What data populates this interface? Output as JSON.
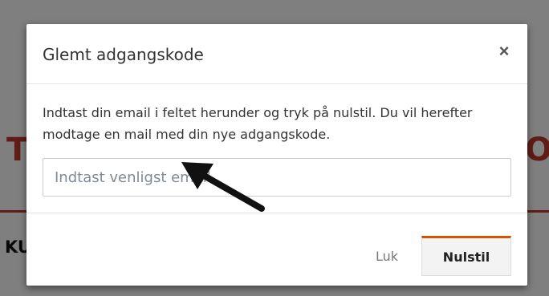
{
  "background": {
    "left_letter": "T",
    "right_letter": "O",
    "left_text": "KU",
    "accent_color": "#c0392b"
  },
  "modal": {
    "title": "Glemt adgangskode",
    "close_icon": "×",
    "help_text": "Indtast din email i feltet herunder og tryk på nulstil. Du vil herefter modtage en mail med din nye adgangskode.",
    "email_input": {
      "value": "",
      "placeholder": "Indtast venligst email.."
    },
    "footer": {
      "close_label": "Luk",
      "reset_label": "Nulstil",
      "reset_accent_color": "#d35400"
    }
  }
}
